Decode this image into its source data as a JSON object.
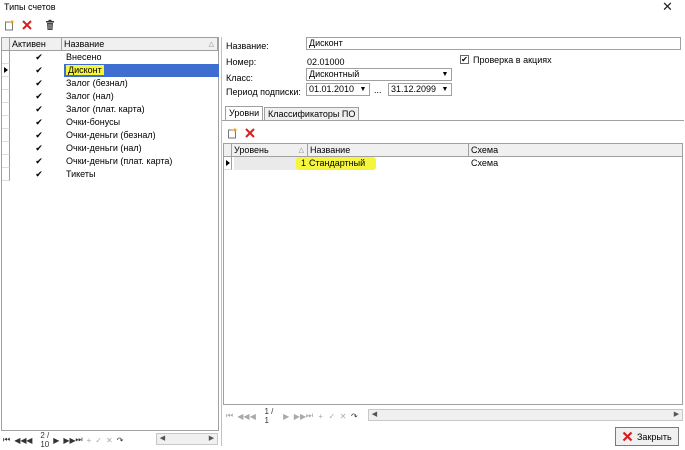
{
  "window": {
    "title": "Типы счетов",
    "close_glyph": "✕"
  },
  "colors": {
    "selection": "#3e6fd0",
    "highlight": "#f5f53b",
    "delete_red": "#d42020"
  },
  "left_toolbar": {
    "icons": [
      "add-icon",
      "delete-icon",
      "trash-icon"
    ]
  },
  "left_grid": {
    "columns": [
      "Активен",
      "Название"
    ],
    "rows": [
      {
        "active": "✔",
        "name": "Внесено"
      },
      {
        "active": "✔",
        "name": "Дисконт"
      },
      {
        "active": "✔",
        "name": "Залог (безнал)"
      },
      {
        "active": "✔",
        "name": "Залог (нал)"
      },
      {
        "active": "✔",
        "name": "Залог (плат. карта)"
      },
      {
        "active": "✔",
        "name": "Очки-бонусы"
      },
      {
        "active": "✔",
        "name": "Очки-деньги (безнал)"
      },
      {
        "active": "✔",
        "name": "Очки-деньги (нал)"
      },
      {
        "active": "✔",
        "name": "Очки-деньги (плат. карта)"
      },
      {
        "active": "✔",
        "name": "Тикеты"
      }
    ],
    "selected_index": 1,
    "navigator": {
      "page": "2 / 10"
    }
  },
  "form": {
    "name_label": "Название:",
    "name_value": "Дисконт",
    "number_label": "Номер:",
    "number_value": "02.01000",
    "promo_check_label": "Проверка в акциях",
    "promo_checked": "✔",
    "class_label": "Класс:",
    "class_value": "Дисконтный",
    "period_label": "Период подписки:",
    "period_from": "01.01.2010",
    "period_sep": "...",
    "period_to": "31.12.2099"
  },
  "tabs": [
    {
      "label": "Уровни",
      "active": true
    },
    {
      "label": "Классификаторы ПО",
      "active": false
    }
  ],
  "levels_toolbar": {
    "icons": [
      "add-icon",
      "delete-icon"
    ]
  },
  "levels_grid": {
    "columns": [
      "Уровень",
      "Название",
      "Схема"
    ],
    "rows": [
      {
        "level": "1",
        "name": "Стандартный",
        "scheme": "Схема"
      }
    ],
    "navigator": {
      "page": "1 / 1"
    }
  },
  "close_button": {
    "label": "Закрыть"
  }
}
